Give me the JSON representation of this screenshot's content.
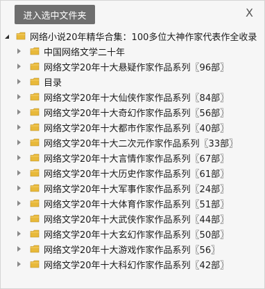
{
  "toolbar": {
    "enter_label": "进入选中文件夹",
    "close_label": "X"
  },
  "tree": {
    "root": {
      "label": "网络小说20年精华合集：100多位大神作家代表作全收录",
      "icon": "folder-icon"
    },
    "children": [
      {
        "label": "中国网络文学二十年"
      },
      {
        "label": "网络文学20年十大悬疑作家作品系列〖96部〗"
      },
      {
        "label": "目录"
      },
      {
        "label": "网络文学20年十大仙侠作家作品系列〖84部〗"
      },
      {
        "label": "网络文学20年十大奇幻作家作品系列〖56部〗"
      },
      {
        "label": "网络文学20年十大都市作家作品系列〖40部〗"
      },
      {
        "label": "网络文学20年十大二次元作家作品系列〖33部〗"
      },
      {
        "label": "网络文学20年十大言情作家作品系列〖67部〗"
      },
      {
        "label": "网络文学20年十大历史作家作品系列〖61部〗"
      },
      {
        "label": "网络文学20年十大军事作家作品系列〖24部〗"
      },
      {
        "label": "网络文学20年十大体育作家作品系列〖51部〗"
      },
      {
        "label": "网络文学20年十大武侠作家作品系列〖44部〗"
      },
      {
        "label": "网络文学20年十大玄幻作家作品系列〖50部〗"
      },
      {
        "label": "网络文学20年十大游戏作家作品系列〖56〗"
      },
      {
        "label": "网络文学20年十大科幻作家作品系列〖42部〗"
      }
    ]
  },
  "colors": {
    "button_bg": "#6e6e6e",
    "folder_yellow": "#e8b93a",
    "panel_bg": "#f6f6f6"
  }
}
